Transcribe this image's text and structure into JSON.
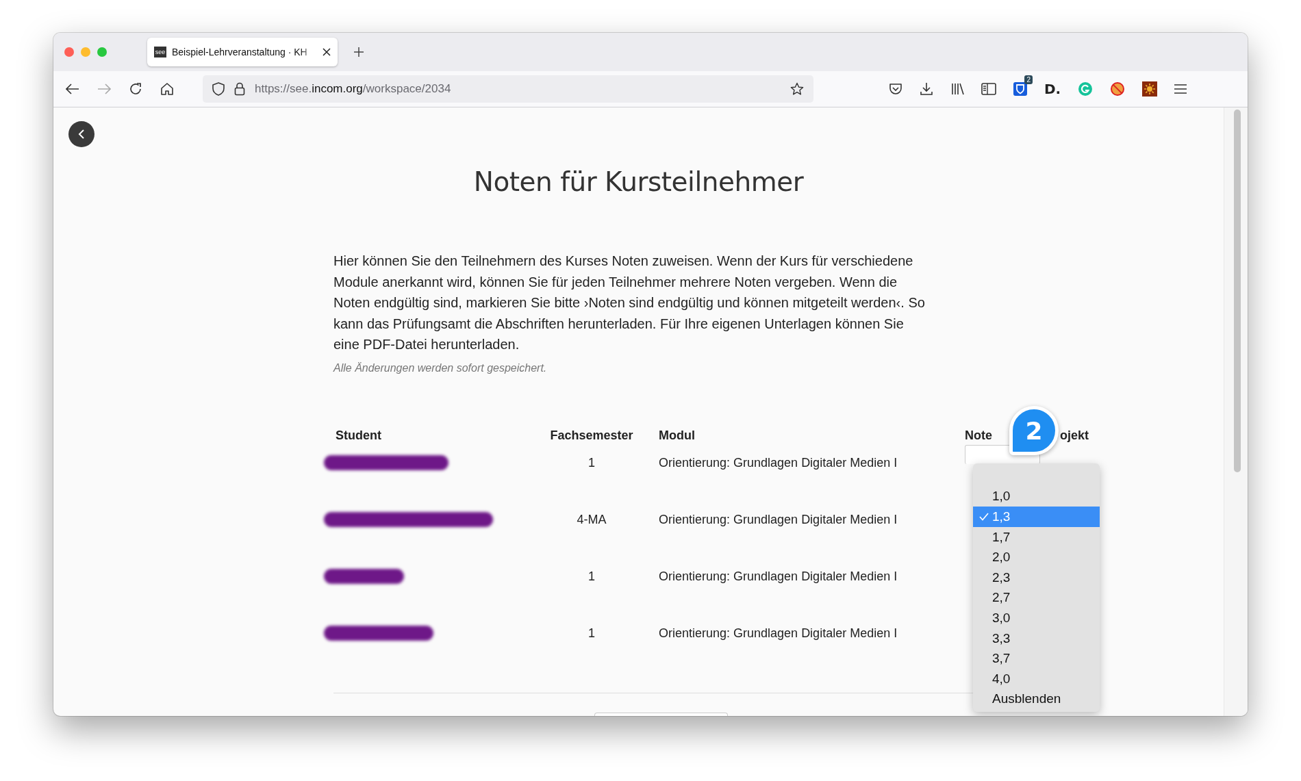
{
  "tab": {
    "favicon": "see",
    "title": "Beispiel-Lehrveranstaltung · KH",
    "selected": true
  },
  "address_bar": {
    "prefix": "https://see.",
    "domain": "incom.org",
    "path": "/workspace/2034"
  },
  "extensions": {
    "bitwarden_badge": "2",
    "d_logo": "D."
  },
  "page": {
    "title": "Noten für Kursteilnehmer",
    "intro": "Hier können Sie den Teilnehmern des Kurses Noten zuweisen. Wenn der Kurs für verschiedene Module anerkannt wird, können Sie für jeden Teilnehmer mehrere Noten vergeben. Wenn die Noten endgültig sind, markieren Sie bitte ›Noten sind endgültig und können mitgeteilt werden‹. So kann das Prüfungsamt die Abschriften herunterladen. Für Ihre eigenen Unterlagen können Sie eine PDF-Datei herunterladen.",
    "note": "Alle Änderungen werden sofort gespeichert."
  },
  "table": {
    "columns": [
      "Student",
      "Fachsemester",
      "Modul",
      "Note",
      "ojekt"
    ],
    "rows": [
      {
        "student_redacted": true,
        "semester": "1",
        "module": "Orientierung: Grundlagen Digitaler Medien I"
      },
      {
        "student_redacted": true,
        "semester": "4-MA",
        "module": "Orientierung: Grundlagen Digitaler Medien I"
      },
      {
        "student_redacted": true,
        "semester": "1",
        "module": "Orientierung: Grundlagen Digitaler Medien I"
      },
      {
        "student_redacted": true,
        "semester": "1",
        "module": "Orientierung: Grundlagen Digitaler Medien I"
      }
    ]
  },
  "step_badge": "2",
  "grade_dropdown": [
    {
      "label": "1,0",
      "selected": false
    },
    {
      "label": "1,3",
      "selected": true
    },
    {
      "label": "1,7",
      "selected": false
    },
    {
      "label": "2,0",
      "selected": false
    },
    {
      "label": "2,3",
      "selected": false
    },
    {
      "label": "2,7",
      "selected": false
    },
    {
      "label": "3,0",
      "selected": false
    },
    {
      "label": "3,3",
      "selected": false
    },
    {
      "label": "3,7",
      "selected": false
    },
    {
      "label": "4,0",
      "selected": false
    },
    {
      "label": "Ausblenden",
      "selected": false
    }
  ]
}
